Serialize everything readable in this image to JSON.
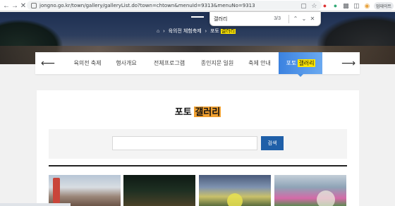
{
  "browser": {
    "back_icon": "back-arrow-icon",
    "forward_icon": "forward-arrow-icon",
    "reload_icon": "close-icon",
    "url": "jongno.go.kr/town/gallery/galleryList.do?town=chtown&menuId=9313&menuNo=9313",
    "profile_label": "업데이트"
  },
  "findbar": {
    "query": "갤러리",
    "count": "3/3"
  },
  "hero": {
    "breadcrumb": [
      "육의전 체험축제",
      "포토 갤러리"
    ],
    "breadcrumb_plain": "포토",
    "breadcrumb_highlight": "갤러리"
  },
  "tabs": {
    "items": [
      {
        "label": "육의전 축제"
      },
      {
        "label": "행사개요"
      },
      {
        "label": "전체프로그램"
      },
      {
        "label": "종인지문 일원"
      },
      {
        "label": "축제 안내"
      }
    ],
    "active_plain": "포토",
    "active_highlight": "갤러리"
  },
  "main": {
    "title_plain": "포토",
    "title_highlight": "갤러리",
    "search_placeholder": "",
    "search_button": "검색"
  },
  "colors": {
    "accent": "#4a90e2",
    "search_button": "#1f5fa8",
    "find_highlight": "#ffe600",
    "title_highlight": "#f0a030"
  }
}
